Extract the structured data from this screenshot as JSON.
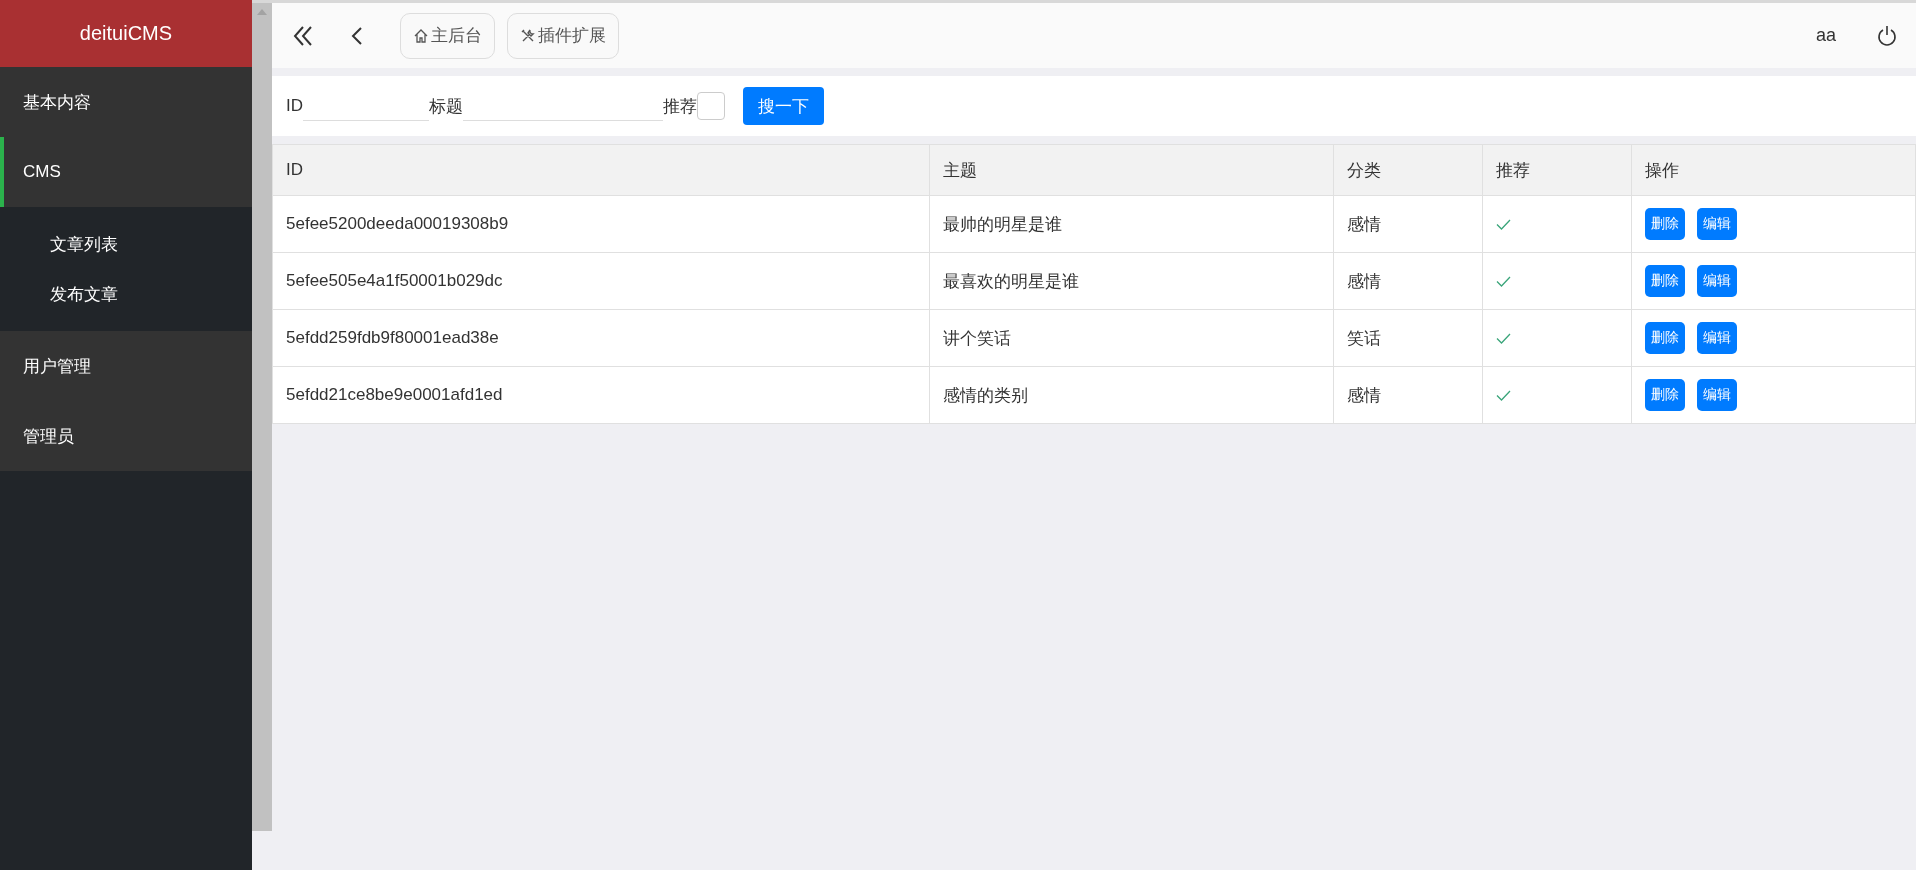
{
  "sidebar": {
    "brand": "deituiCMS",
    "items": [
      {
        "label": "基本内容",
        "selected": false
      },
      {
        "label": "CMS",
        "selected": true,
        "expanded": true,
        "children": [
          {
            "label": "文章列表",
            "selected": false
          },
          {
            "label": "发布文章",
            "selected": false
          }
        ]
      },
      {
        "label": "用户管理",
        "selected": false
      },
      {
        "label": "管理员",
        "selected": false
      }
    ]
  },
  "toolbar": {
    "tabs": [
      {
        "label": "主后台"
      },
      {
        "label": "插件扩展"
      }
    ],
    "user": "aa"
  },
  "search": {
    "fields": [
      {
        "label": "ID"
      },
      {
        "label": "标题"
      }
    ],
    "recommend": {
      "label": "推荐",
      "checked": false
    },
    "button": "搜一下"
  },
  "table": {
    "columns": [
      "ID",
      "主题",
      "分类",
      "推荐",
      "操作"
    ],
    "rows": [
      {
        "id": "5efee5200deeda00019308b9",
        "title": "最帅的明星是谁",
        "category": "感情",
        "recommended": true,
        "actions": [
          "删除",
          "编辑"
        ]
      },
      {
        "id": "5efee505e4a1f50001b029dc",
        "title": "最喜欢的明星是谁",
        "category": "感情",
        "recommended": true,
        "actions": [
          "删除",
          "编辑"
        ]
      },
      {
        "id": "5efdd259fdb9f80001ead38e",
        "title": "讲个笑话",
        "category": "笑话",
        "recommended": true,
        "actions": [
          "删除",
          "编辑"
        ]
      },
      {
        "id": "5efdd21ce8be9e0001afd1ed",
        "title": "感情的类别",
        "category": "感情",
        "recommended": true,
        "actions": [
          "删除",
          "编辑"
        ]
      }
    ]
  }
}
